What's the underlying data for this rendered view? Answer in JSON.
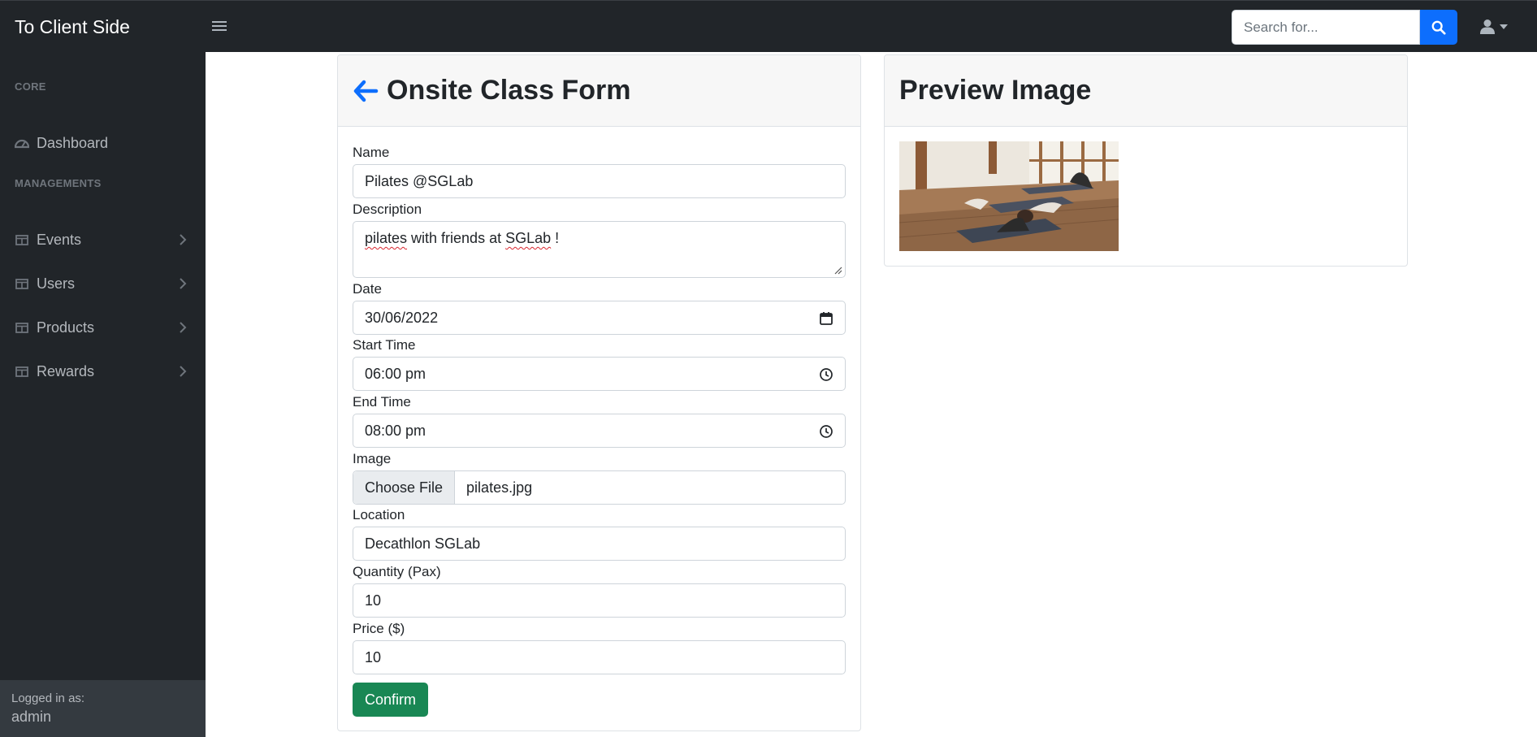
{
  "app": {
    "brand": "To Client Side"
  },
  "topnav": {
    "search_placeholder": "Search for..."
  },
  "sidebar": {
    "sections": [
      {
        "heading": "CORE"
      },
      {
        "heading": "MANAGEMENTS"
      }
    ],
    "items": [
      {
        "label": "Dashboard",
        "icon": "tachometer-icon"
      },
      {
        "label": "Events",
        "icon": "table-icon"
      },
      {
        "label": "Users",
        "icon": "table-icon"
      },
      {
        "label": "Products",
        "icon": "table-icon"
      },
      {
        "label": "Rewards",
        "icon": "table-icon"
      }
    ],
    "footer": {
      "caption": "Logged in as:",
      "user": "admin"
    }
  },
  "form_card": {
    "title": "Onsite Class Form",
    "fields": {
      "name": {
        "label": "Name",
        "value": "Pilates @SGLab"
      },
      "description": {
        "label": "Description",
        "value_words": [
          "pilates",
          " with friends at ",
          "SGLab",
          " !"
        ]
      },
      "date": {
        "label": "Date",
        "value": "30/06/2022"
      },
      "start_time": {
        "label": "Start Time",
        "value": "06:00 pm"
      },
      "end_time": {
        "label": "End Time",
        "value": "08:00 pm"
      },
      "image": {
        "label": "Image",
        "button": "Choose File",
        "file": "pilates.jpg"
      },
      "location": {
        "label": "Location",
        "value": "Decathlon SGLab"
      },
      "quantity": {
        "label": "Quantity (Pax)",
        "value": "10"
      },
      "price": {
        "label": "Price ($)",
        "value": "10"
      }
    },
    "confirm_label": "Confirm"
  },
  "preview_card": {
    "title": "Preview Image"
  },
  "colors": {
    "nav_bg": "#212529",
    "primary": "#0d6efd",
    "success": "#198754"
  }
}
